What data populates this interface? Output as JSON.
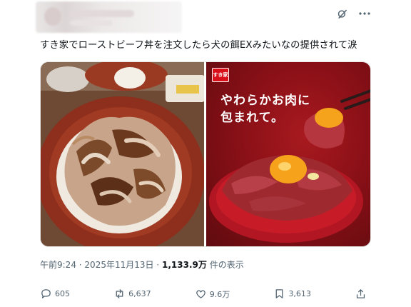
{
  "header": {
    "icons": [
      "grok-icon",
      "more-icon"
    ]
  },
  "tweet": {
    "text": "すき家でローストビーフ丼を注文したら犬の餌EXみたいなの提供されて涙"
  },
  "media": {
    "ad_logo": "すき家",
    "ad_copy_line1": "やわらかお肉に",
    "ad_copy_line2": "包まれて。"
  },
  "meta": {
    "time": "午前9:24",
    "date": "2025年11月13日",
    "views": "1,133.9万",
    "views_suffix": "件の表示"
  },
  "actions": {
    "replies": "605",
    "reposts": "6,637",
    "likes": "9.6万",
    "bookmarks": "3,613"
  },
  "colors": {
    "text": "#0f1419",
    "secondary": "#536471",
    "ad_red": "#8a1017"
  }
}
